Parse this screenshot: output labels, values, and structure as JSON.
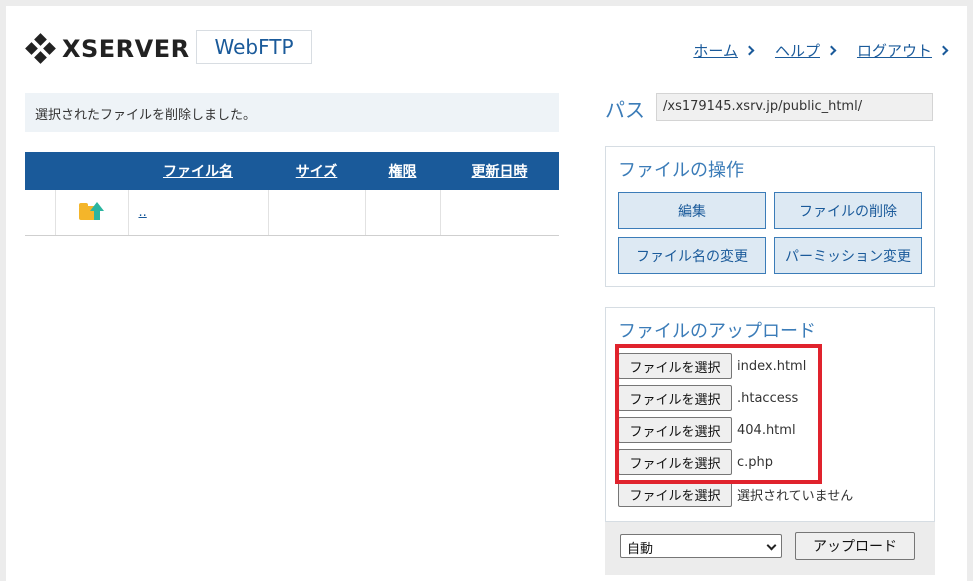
{
  "brand": {
    "name": "XSERVER",
    "product": "WebFTP"
  },
  "nav": [
    {
      "label": "ホーム"
    },
    {
      "label": "ヘルプ"
    },
    {
      "label": "ログアウト"
    }
  ],
  "message": "選択されたファイルを削除しました。",
  "table": {
    "headers": [
      "",
      "",
      "ファイル名",
      "サイズ",
      "権限",
      "更新日時"
    ],
    "rows": [
      {
        "icon": "parent-folder-up-icon",
        "name": "..",
        "size": "",
        "perm": "",
        "date": ""
      }
    ]
  },
  "path": {
    "label": "パス",
    "value": "/xs179145.xsrv.jp/public_html/"
  },
  "operations": {
    "title": "ファイルの操作",
    "buttons": [
      "編集",
      "ファイルの削除",
      "ファイル名の変更",
      "パーミッション変更"
    ]
  },
  "upload": {
    "title": "ファイルのアップロード",
    "choose_label": "ファイルを選択",
    "files": [
      "index.html",
      ".htaccess",
      "404.html",
      "c.php",
      "選択されていません"
    ],
    "encoding": "自動",
    "button": "アップロード",
    "highlight_color": "#e0232d"
  },
  "colors": {
    "brand_blue": "#1a5a9a",
    "accent_blue": "#3b7cb8",
    "folder": "#f4b52a",
    "arrow": "#2bb5a0"
  }
}
